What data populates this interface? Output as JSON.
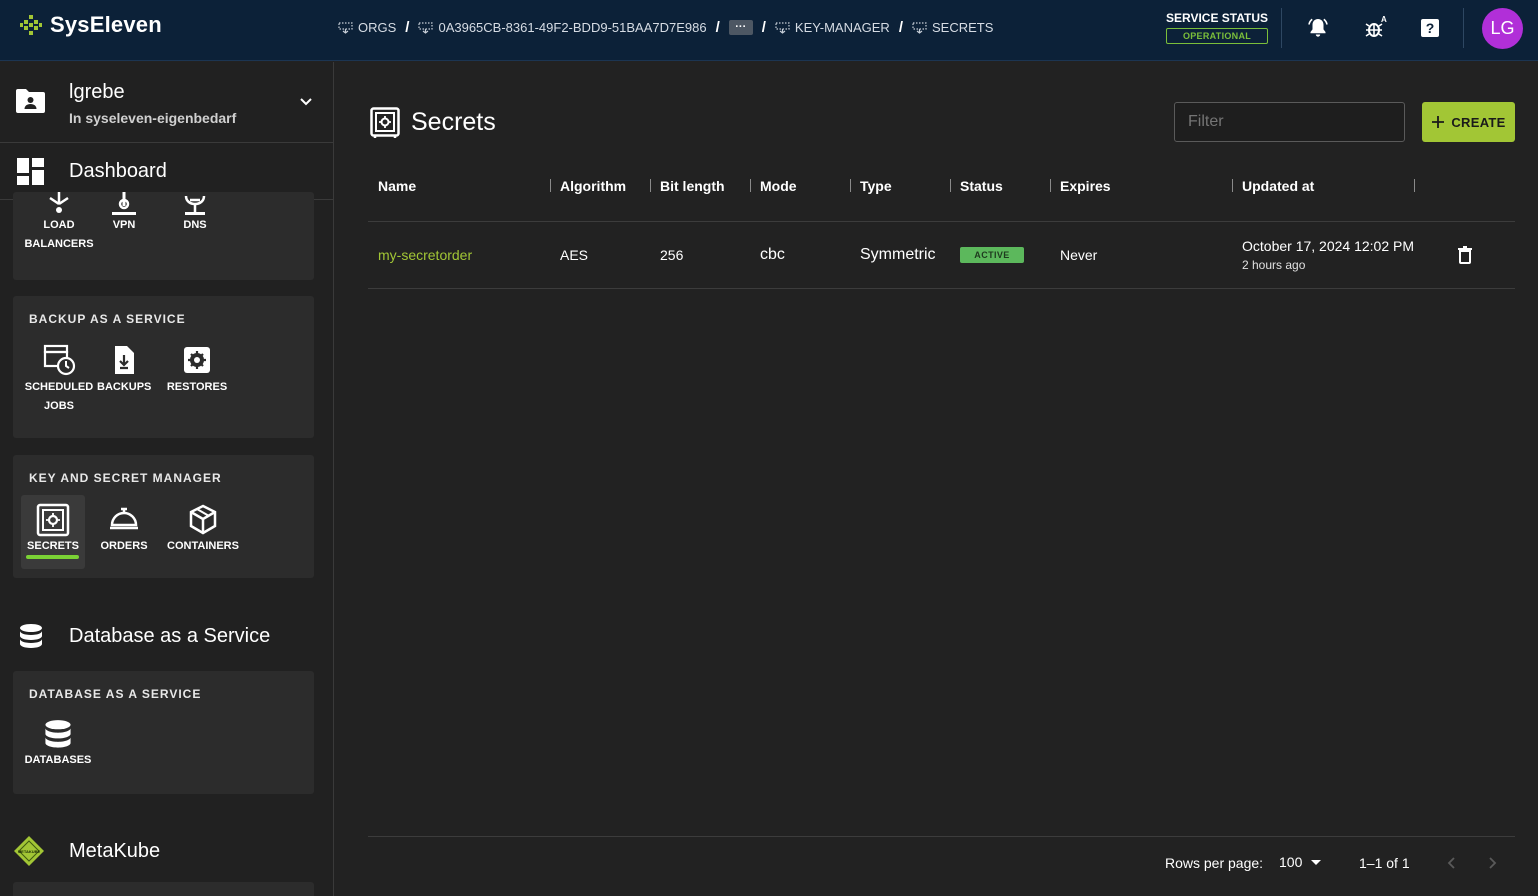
{
  "brand": {
    "name": "SysEleven"
  },
  "breadcrumb": [
    {
      "label": "ORGS"
    },
    {
      "label": "0A3965CB-8361-49F2-BDD9-51BAA7D7E986"
    },
    {
      "label": "···"
    },
    {
      "label": "KEY-MANAGER"
    },
    {
      "label": "SECRETS"
    }
  ],
  "service_status": {
    "title": "SERVICE STATUS",
    "value": "OPERATIONAL"
  },
  "user": {
    "initials": "LG",
    "debug_badge": "A"
  },
  "sidebar": {
    "project": {
      "name": "lgrebe",
      "org": "In syseleven-eigenbedarf"
    },
    "dashboard_label": "Dashboard",
    "network_tiles": {
      "load_balancers": "LOAD BALANCERS",
      "vpn": "VPN",
      "dns": "DNS"
    },
    "backup": {
      "title": "BACKUP AS A SERVICE",
      "tiles": {
        "scheduled_jobs": "SCHEDULED JOBS",
        "backups": "BACKUPS",
        "restores": "RESTORES"
      }
    },
    "kms": {
      "title": "KEY AND SECRET MANAGER",
      "tiles": {
        "secrets": "SECRETS",
        "orders": "ORDERS",
        "containers": "CONTAINERS"
      }
    },
    "dbaas": {
      "section": "Database as a Service",
      "title": "DATABASE AS A SERVICE",
      "tiles": {
        "databases": "DATABASES"
      }
    },
    "metakube": {
      "section": "MetaKube",
      "logo_text": "METAKUBE"
    }
  },
  "main": {
    "title": "Secrets",
    "filter_placeholder": "Filter",
    "create_label": "CREATE",
    "columns": {
      "name": "Name",
      "algorithm": "Algorithm",
      "bit_length": "Bit length",
      "mode": "Mode",
      "type": "Type",
      "status": "Status",
      "expires": "Expires",
      "updated_at": "Updated at"
    },
    "rows": [
      {
        "name": "my-secretorder",
        "algorithm": "AES",
        "bit_length": "256",
        "mode": "cbc",
        "type": "Symmetric",
        "status": "ACTIVE",
        "expires": "Never",
        "updated_at": "October 17, 2024 12:02 PM",
        "updated_rel": "2 hours ago"
      }
    ],
    "pagination": {
      "rows_per_page_label": "Rows per page:",
      "rows_per_page": "100",
      "range": "1–1 of 1"
    }
  },
  "colors": {
    "accent": "#a2c635",
    "topbar": "#0c2138",
    "avatar": "#b12fd8",
    "active": "#5cb85c"
  }
}
